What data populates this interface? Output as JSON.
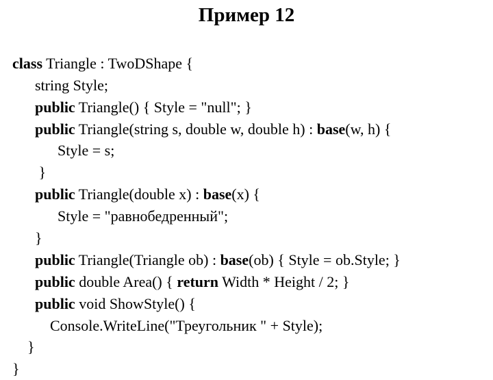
{
  "title": "Пример 12",
  "code": {
    "l1_kw": "class",
    "l1_rest": " Triangle : TwoDShape {",
    "l2": "      string Style;",
    "l3_pad": "      ",
    "l3_kw": "public",
    "l3_rest": " Triangle() { Style = \"null\"; }",
    "l4_pad": "      ",
    "l4_kw": "public",
    "l4_mid": " Triangle(string s, double w, double h) : ",
    "l4_kw2": "base",
    "l4_rest": "(w, h) {",
    "l5": "            Style = s;",
    "l6": "       }",
    "l7_pad": "      ",
    "l7_kw": "public",
    "l7_mid": " Triangle(double x) : ",
    "l7_kw2": "base",
    "l7_rest": "(x) {",
    "l8": "            Style = \"равнобедренный\";",
    "l9": "      }",
    "l10_pad": "      ",
    "l10_kw": "public",
    "l10_mid": " Triangle(Triangle ob) : ",
    "l10_kw2": "base",
    "l10_rest": "(ob) { Style = ob.Style; }",
    "l11_pad": "      ",
    "l11_kw": "public",
    "l11_mid": " double Area() { ",
    "l11_kw2": "return",
    "l11_rest": " Width * Height / 2; }",
    "l12_pad": "      ",
    "l12_kw": "public",
    "l12_rest": " void ShowStyle() {",
    "l13": "          Console.WriteLine(\"Треугольник \" + Style);",
    "l14": "    }",
    "l15": "}"
  }
}
